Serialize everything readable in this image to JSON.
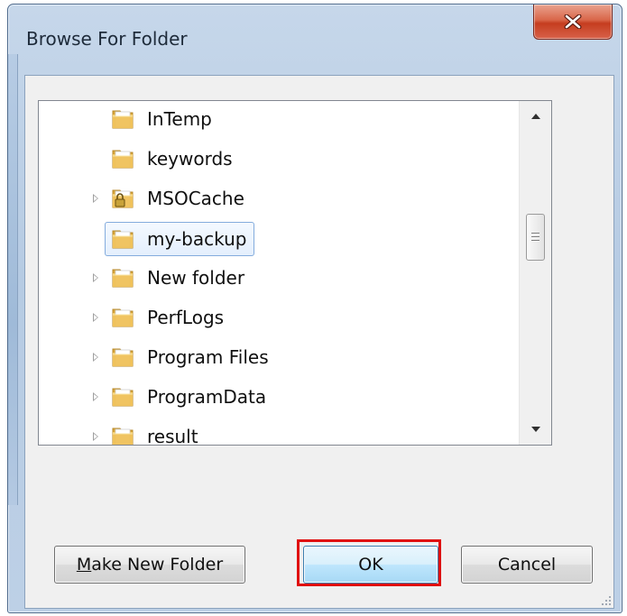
{
  "window": {
    "title": "Browse For Folder",
    "close_icon": "close-icon"
  },
  "folder_tree": {
    "items": [
      {
        "label": "InTemp",
        "icon": "folder-icon",
        "expandable": false,
        "locked": false,
        "selected": false
      },
      {
        "label": "keywords",
        "icon": "folder-icon",
        "expandable": false,
        "locked": false,
        "selected": false
      },
      {
        "label": "MSOCache",
        "icon": "locked-folder-icon",
        "expandable": true,
        "locked": true,
        "selected": false
      },
      {
        "label": "my-backup",
        "icon": "folder-icon",
        "expandable": false,
        "locked": false,
        "selected": true
      },
      {
        "label": "New folder",
        "icon": "folder-icon",
        "expandable": true,
        "locked": false,
        "selected": false
      },
      {
        "label": "PerfLogs",
        "icon": "folder-icon",
        "expandable": true,
        "locked": false,
        "selected": false
      },
      {
        "label": "Program Files",
        "icon": "folder-icon",
        "expandable": true,
        "locked": false,
        "selected": false
      },
      {
        "label": "ProgramData",
        "icon": "folder-icon",
        "expandable": true,
        "locked": false,
        "selected": false
      },
      {
        "label": "result",
        "icon": "folder-icon",
        "expandable": true,
        "locked": false,
        "selected": false
      }
    ]
  },
  "buttons": {
    "make_new_folder": "Make New Folder",
    "ok": "OK",
    "cancel": "Cancel"
  },
  "colors": {
    "highlight": "#e01010",
    "selection_border": "#84acdd",
    "folder": "#e9b94a"
  }
}
